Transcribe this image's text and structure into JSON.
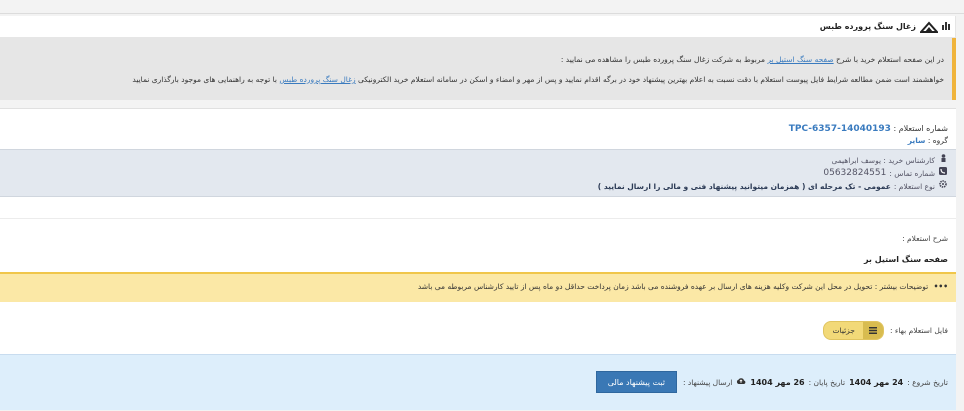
{
  "header": {
    "title": "زغال سنگ پرورده طبس",
    "bars_icon": "bar-chart-icon",
    "logo_icon": "company-logo"
  },
  "intro": {
    "line1_pre": "در این صفحه استعلام خرید با شرح",
    "line1_link": "صفحه سنگ استیل بر",
    "line1_post": "مربوط به شرکت زغال سنگ پرورده طبس را مشاهده می نمایید :",
    "line2_pre": "خواهشمند است ضمن مطالعه شرایط فایل پیوست استعلام با دقت نسبت به اعلام بهترین پیشنهاد خود در برگه اقدام نمایید و پس از مهر و امضاء و اسکن در سامانه استعلام خرید الکترونیکی",
    "line2_link": "زغال سنگ پرورده طبس",
    "line2_post": "با توجه به راهنمایی های موجود بارگذاری نمایید"
  },
  "rfq": {
    "number_label": "شماره استعلام :",
    "number_value": "TPC-6357-14040193",
    "group_label": "گروه :",
    "group_value": "سایر"
  },
  "contact": {
    "buyer_label": "کارشناس خرید : یوسف ابراهیمی",
    "phone_label": "شماره تماس :",
    "phone_value": "05632824551",
    "type_label": "نوع استعلام :",
    "type_value": "عمومی - تک مرحله ای ( همزمان میتوانید پیشنهاد فنی و مالی را ارسال نمایید )"
  },
  "description": {
    "label": "شرح استعلام :",
    "value": "صفحه سنگ استیل بر"
  },
  "notice": {
    "label": "توضیحات بیشتر :",
    "text": "تحویل در محل این شرکت وکلیه هزینه های ارسال بر عهده فروشنده می باشد زمان پرداخت حداقل دو ماه پس از تایید کارشناس مربوطه می باشد"
  },
  "file": {
    "label": "فایل استعلام بهاء :",
    "button_label": "جزئیات",
    "button_icon": "list-icon"
  },
  "dates": {
    "start_label": "تاریخ شروع :",
    "start_value": "24 مهر 1404",
    "end_label": "تاریخ پایان :",
    "end_value": "26 مهر 1404",
    "send_label": "ارسال پیشنهاد :",
    "submit_label": "ثبت پیشنهاد مالی"
  },
  "colors": {
    "accent": "#f0b43c",
    "link": "#3a7bbf",
    "submit": "#3a78b5",
    "notice_bg": "#fbe8a6"
  }
}
